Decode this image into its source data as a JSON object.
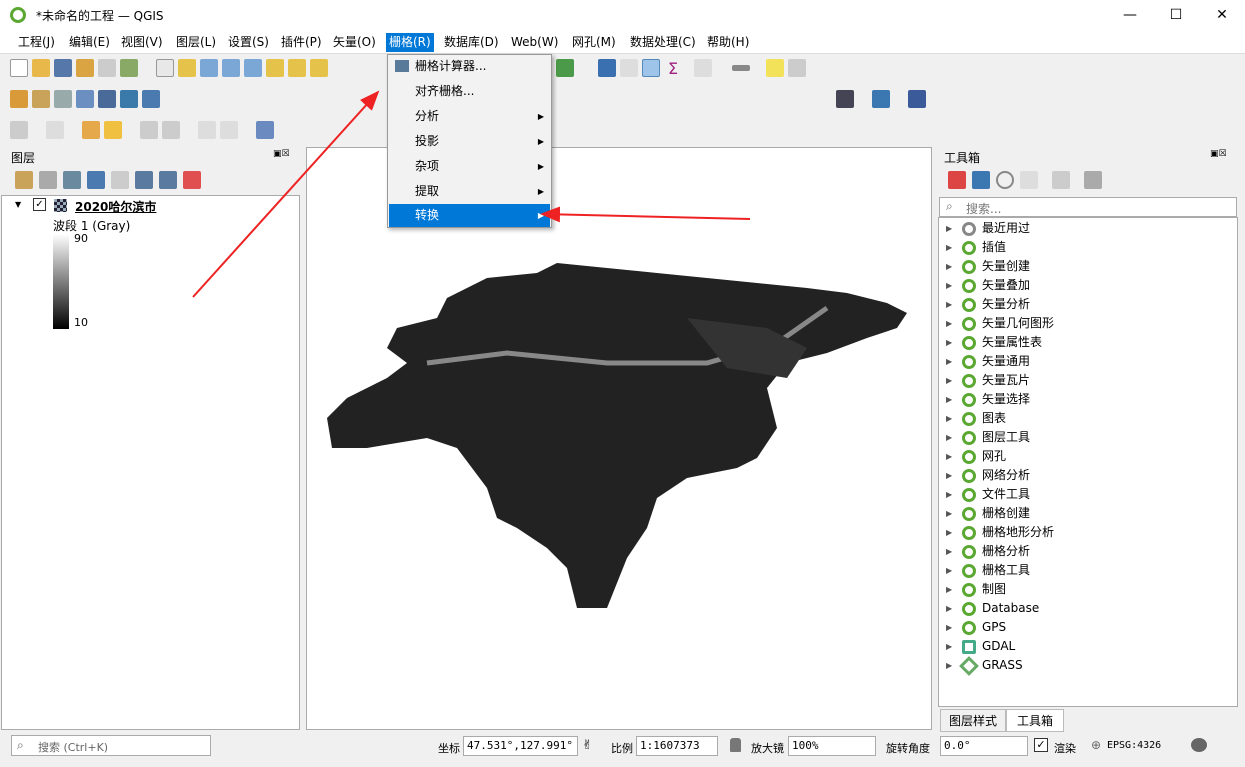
{
  "window": {
    "title": "*未命名的工程 — QGIS",
    "minimize": "—",
    "maximize": "☐",
    "close": "✕"
  },
  "menubar": [
    "工程(J)",
    "编辑(E)",
    "视图(V)",
    "图层(L)",
    "设置(S)",
    "插件(P)",
    "矢量(O)",
    "栅格(R)",
    "数据库(D)",
    "Web(W)",
    "网孔(M)",
    "数据处理(C)",
    "帮助(H)"
  ],
  "raster_menu": {
    "items": [
      {
        "label": "栅格计算器...",
        "submenu": false
      },
      {
        "label": "对齐栅格...",
        "submenu": false
      },
      {
        "label": "分析",
        "submenu": true
      },
      {
        "label": "投影",
        "submenu": true
      },
      {
        "label": "杂项",
        "submenu": true
      },
      {
        "label": "提取",
        "submenu": true
      },
      {
        "label": "转换",
        "submenu": true,
        "highlighted": true
      }
    ]
  },
  "layers_panel": {
    "title": "图层",
    "layer_name": "2020哈尔滨市",
    "band": "波段 1 (Gray)",
    "max": "90",
    "min": "10"
  },
  "toolbox": {
    "title": "工具箱",
    "search_placeholder": "搜索...",
    "items": [
      "最近用过",
      "插值",
      "矢量创建",
      "矢量叠加",
      "矢量分析",
      "矢量几何图形",
      "矢量属性表",
      "矢量通用",
      "矢量瓦片",
      "矢量选择",
      "图表",
      "图层工具",
      "网孔",
      "网络分析",
      "文件工具",
      "栅格创建",
      "栅格地形分析",
      "栅格分析",
      "栅格工具",
      "制图",
      "Database",
      "GPS",
      "GDAL",
      "GRASS"
    ],
    "tabs": [
      "图层样式",
      "工具箱"
    ]
  },
  "statusbar": {
    "search_placeholder": "搜索 (Ctrl+K)",
    "coord_label": "坐标",
    "coord": "47.531°,127.991°",
    "scale_label": "比例",
    "scale": "1:1607373",
    "magnifier_label": "放大镜",
    "magnifier": "100%",
    "rotation_label": "旋转角度",
    "rotation": "0.0°",
    "render_label": "渲染",
    "crs": "EPSG:4326"
  },
  "colors": {
    "accent": "#0078d7",
    "arrow": "#ee2222",
    "qgis_green": "#5aa832"
  }
}
